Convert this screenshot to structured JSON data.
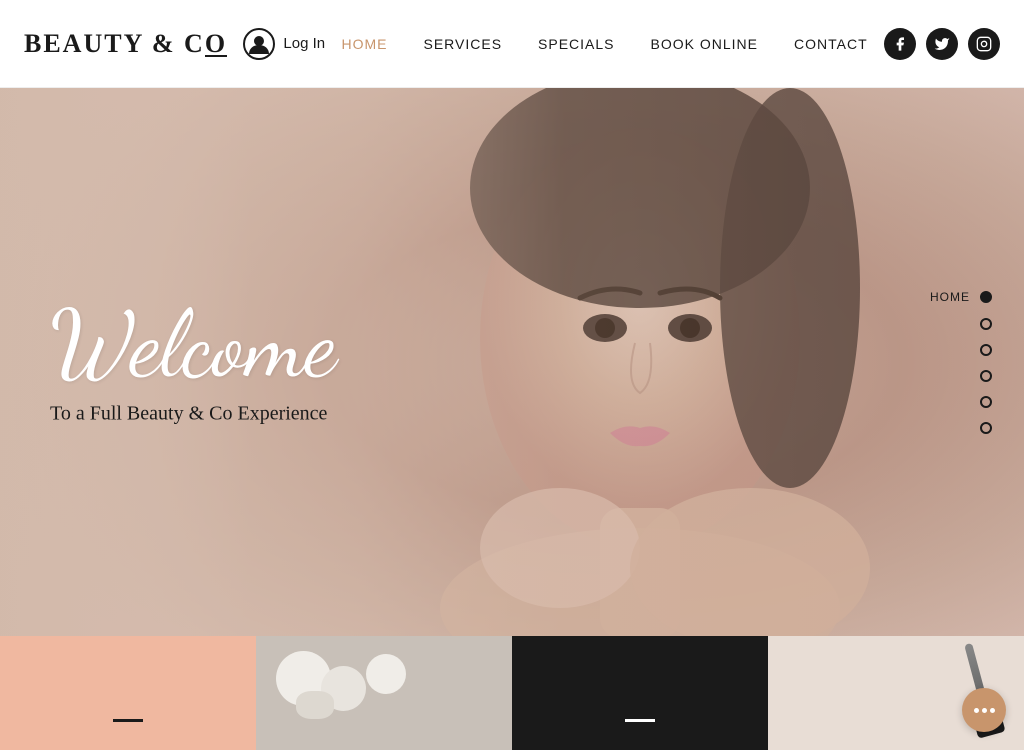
{
  "header": {
    "logo": "BEAUTY & C",
    "logo_co": "o",
    "login_label": "Log In",
    "nav": [
      {
        "id": "home",
        "label": "HOME",
        "active": true
      },
      {
        "id": "services",
        "label": "SERVICES",
        "active": false
      },
      {
        "id": "specials",
        "label": "SPECIALS",
        "active": false
      },
      {
        "id": "book-online",
        "label": "BOOK ONLINE",
        "active": false
      },
      {
        "id": "contact",
        "label": "CONTACT",
        "active": false
      }
    ],
    "social": [
      {
        "id": "facebook",
        "symbol": "f"
      },
      {
        "id": "twitter",
        "symbol": "t"
      },
      {
        "id": "instagram",
        "symbol": "◻"
      }
    ]
  },
  "hero": {
    "welcome_text": "Welcome",
    "subtitle": "To a Full Beauty & Co Experience",
    "scroll_label": "HOME",
    "dot_count": 6
  },
  "bottom_tiles": [
    {
      "id": "tile-pink",
      "type": "pink",
      "has_dash": true
    },
    {
      "id": "tile-stones",
      "type": "stones",
      "has_dash": false
    },
    {
      "id": "tile-black",
      "type": "black",
      "has_dash": true
    },
    {
      "id": "tile-brushes",
      "type": "brushes",
      "has_dash": false
    }
  ],
  "chat": {
    "label": "chat"
  }
}
